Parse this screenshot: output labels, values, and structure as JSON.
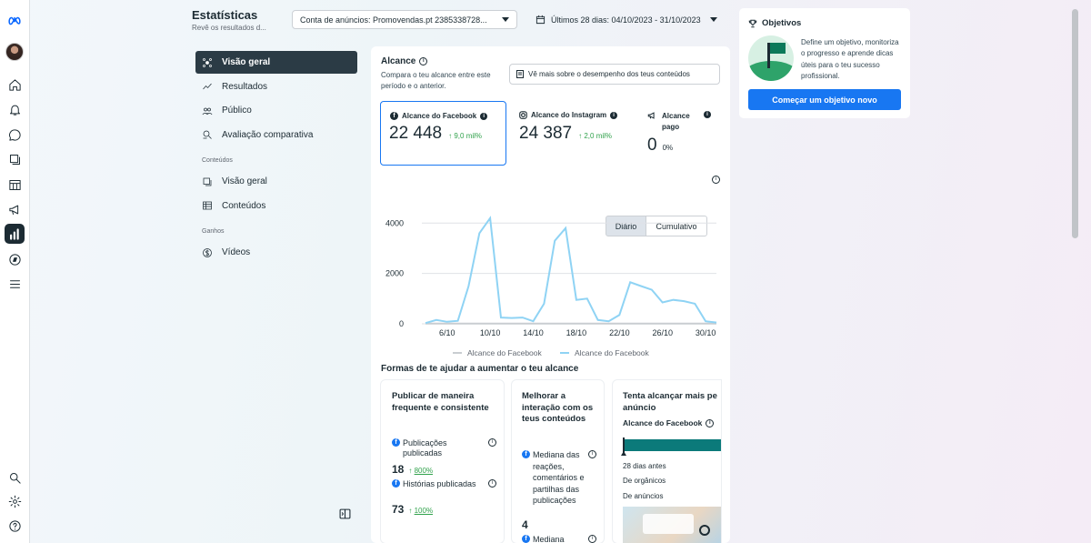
{
  "header": {
    "title": "Estatísticas",
    "subtitle": "Revê os resultados d...",
    "account": "Conta de anúncios: Promovendas.pt 2385338728...",
    "date_range": "Últimos 28 dias: 04/10/2023 - 31/10/2023"
  },
  "nav": {
    "items": [
      {
        "label": "Visão geral"
      },
      {
        "label": "Resultados"
      },
      {
        "label": "Público"
      },
      {
        "label": "Avaliação comparativa"
      }
    ],
    "section_content": "Conteúdos",
    "content_items": [
      {
        "label": "Visão geral"
      },
      {
        "label": "Conteúdos"
      }
    ],
    "section_earnings": "Ganhos",
    "earnings_items": [
      {
        "label": "Vídeos"
      }
    ]
  },
  "reach": {
    "title": "Alcance",
    "desc": "Compara o teu alcance entre este período e o anterior.",
    "more_btn": "Vê mais sobre o desempenho dos teus conteúdos",
    "facebook": {
      "label": "Alcance do Facebook",
      "value": "22 448",
      "change": "9,0 mil%"
    },
    "instagram": {
      "label": "Alcance do Instagram",
      "value": "24 387",
      "change": "2,0 mil%"
    },
    "paid": {
      "label": "Alcance pago",
      "value": "0",
      "change": "0%"
    },
    "toggle_daily": "Diário",
    "toggle_cumulative": "Cumulativo"
  },
  "chart_data": {
    "type": "line",
    "x": [
      "4/10",
      "5/10",
      "6/10",
      "7/10",
      "8/10",
      "9/10",
      "10/10",
      "11/10",
      "12/10",
      "13/10",
      "14/10",
      "15/10",
      "16/10",
      "17/10",
      "18/10",
      "19/10",
      "20/10",
      "21/10",
      "22/10",
      "23/10",
      "24/10",
      "25/10",
      "26/10",
      "27/10",
      "28/10",
      "29/10",
      "30/10",
      "31/10"
    ],
    "x_ticks": [
      "6/10",
      "10/10",
      "14/10",
      "18/10",
      "22/10",
      "26/10",
      "30/10"
    ],
    "y_ticks": [
      "0",
      "2000",
      "4000"
    ],
    "ylim": [
      0,
      4300
    ],
    "series": [
      {
        "name": "Alcance do Facebook",
        "color": "#c9cdd1",
        "values": [
          10,
          10,
          10,
          10,
          10,
          10,
          10,
          10,
          10,
          10,
          10,
          10,
          10,
          10,
          10,
          10,
          10,
          10,
          10,
          10,
          10,
          10,
          10,
          10,
          10,
          10,
          10,
          10
        ]
      },
      {
        "name": "Alcance do Facebook",
        "color": "#8fd3f4",
        "values": [
          30,
          150,
          80,
          120,
          1500,
          3600,
          4200,
          250,
          230,
          250,
          100,
          800,
          3300,
          3800,
          950,
          1000,
          150,
          100,
          350,
          1650,
          1500,
          1350,
          850,
          950,
          900,
          800,
          100,
          50
        ]
      }
    ]
  },
  "help": {
    "title": "Formas de te ajudar a aumentar o teu alcance",
    "c1": {
      "title": "Publicar de maneira frequente e consistente",
      "m1_label": "Publicações publicadas",
      "m1_value": "18",
      "m1_change": "800%",
      "m2_label": "Histórias publicadas",
      "m2_value": "73",
      "m2_change": "100%"
    },
    "c2": {
      "title": "Melhorar a interação com os teus conteúdos",
      "m1_label": "Mediana das reações, comentários e partilhas das publicações",
      "m1_value": "4",
      "m2_label": "Mediana"
    },
    "c3": {
      "title": "Tenta alcançar mais pe anúncio",
      "sub": "Alcance do Facebook",
      "t1": "28 dias antes",
      "t2": "De orgânicos",
      "t3": "De anúncios"
    }
  },
  "goals": {
    "title": "Objetivos",
    "desc": "Define um objetivo, monitoriza o progresso e aprende dicas úteis para o teu sucesso profissional.",
    "button": "Começar um objetivo novo"
  }
}
